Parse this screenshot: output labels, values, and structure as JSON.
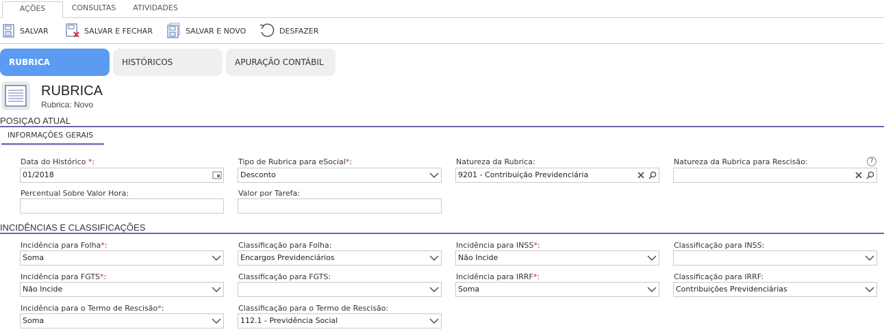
{
  "ribbon": {
    "tabs": [
      "AÇÕES",
      "CONSULTAS",
      "ATIVIDADES"
    ]
  },
  "toolbar": {
    "save": "SALVAR",
    "save_close": "SALVAR E FECHAR",
    "save_new": "SALVAR E NOVO",
    "undo": "DESFAZER"
  },
  "section_tabs": [
    "RUBRICA",
    "HISTÓRICOS",
    "APURAÇÃO CONTÁBIL"
  ],
  "header": {
    "title": "RUBRICA",
    "subtitle": "Rubrica: Novo"
  },
  "sections": {
    "posicao": "POSIÇAO ATUAL",
    "info_tab": "INFORMAÇÕES GERAIS",
    "incidencias": "INCIDÊNCIAS E CLASSIFICAÇÕES"
  },
  "fields": {
    "data_historico": {
      "label": "Data do Histórico ",
      "req": "*",
      "suffix": ":",
      "value": "01/2018"
    },
    "tipo_rubrica": {
      "label": "Tipo de Rubrica para eSocial",
      "req": "*",
      "suffix": ":",
      "value": "Desconto"
    },
    "natureza": {
      "label": "Natureza da Rubrica:",
      "value": "9201 - Contribuição Previdenciária"
    },
    "natureza_rescisao": {
      "label": "Natureza da Rubrica para Rescisão:",
      "value": ""
    },
    "percentual": {
      "label": "Percentual Sobre Valor Hora:",
      "value": ""
    },
    "valor_tarefa": {
      "label": "Valor por Tarefa:",
      "value": ""
    },
    "inc_folha": {
      "label": "Incidência para Folha",
      "req": "*",
      "suffix": ":",
      "value": "Soma"
    },
    "class_folha": {
      "label": "Classificação para Folha:",
      "value": "Encargos Previdenciários"
    },
    "inc_inss": {
      "label": "Incidência para INSS",
      "req": "*",
      "suffix": ":",
      "value": "Não Incide"
    },
    "class_inss": {
      "label": "Classificação para INSS:",
      "value": ""
    },
    "inc_fgts": {
      "label": "Incidência para FGTS",
      "req": "*",
      "suffix": ":",
      "value": "Não Incide"
    },
    "class_fgts": {
      "label": "Classificação para FGTS:",
      "value": ""
    },
    "inc_irrf": {
      "label": "Incidência para IRRF",
      "req": "*",
      "suffix": ":",
      "value": "Soma"
    },
    "class_irrf": {
      "label": "Classificação para IRRF:",
      "value": "Contribuições Previdenciárias"
    },
    "inc_termo": {
      "label": "Incidência para o Termo de Rescisão",
      "req": "*",
      "suffix": ":",
      "value": "Soma"
    },
    "class_termo": {
      "label": "Classificação para o Termo de Rescisão:",
      "value": "112.1 - Previdência Social"
    }
  },
  "help_icon": "?",
  "colors": {
    "accent": "#5b9cf2",
    "section_line": "#6b64a8",
    "required": "#d42020"
  }
}
